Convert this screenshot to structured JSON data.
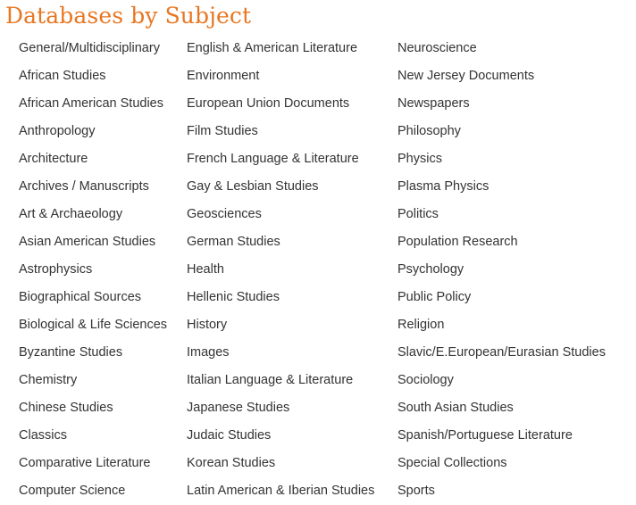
{
  "title": "Databases by Subject",
  "columns": [
    {
      "items": [
        "General/Multidisciplinary",
        "African Studies",
        "African American Studies",
        "Anthropology",
        "Architecture",
        "Archives / Manuscripts",
        "Art & Archaeology",
        "Asian American Studies",
        "Astrophysics",
        "Biographical Sources",
        "Biological & Life Sciences",
        "Byzantine Studies",
        "Chemistry",
        "Chinese Studies",
        "Classics",
        "Comparative Literature",
        "Computer Science"
      ]
    },
    {
      "items": [
        "English & American Literature",
        "Environment",
        "European Union Documents",
        "Film Studies",
        "French Language & Literature",
        "Gay & Lesbian Studies",
        "Geosciences",
        "German Studies",
        "Health",
        "Hellenic Studies",
        "History",
        "Images",
        "Italian Language & Literature",
        "Japanese Studies",
        "Judaic Studies",
        "Korean Studies",
        "Latin American & Iberian Studies"
      ]
    },
    {
      "items": [
        "Neuroscience",
        "New Jersey Documents",
        "Newspapers",
        "Philosophy",
        "Physics",
        "Plasma Physics",
        "Politics",
        "Population Research",
        "Psychology",
        "Public Policy",
        "Religion",
        "Slavic/E.European/Eurasian Studies",
        "Sociology",
        "South Asian Studies",
        "Spanish/Portuguese Literature",
        "Special Collections",
        "Sports"
      ]
    }
  ],
  "colors": {
    "title": "#e87722",
    "link": "#333333"
  }
}
